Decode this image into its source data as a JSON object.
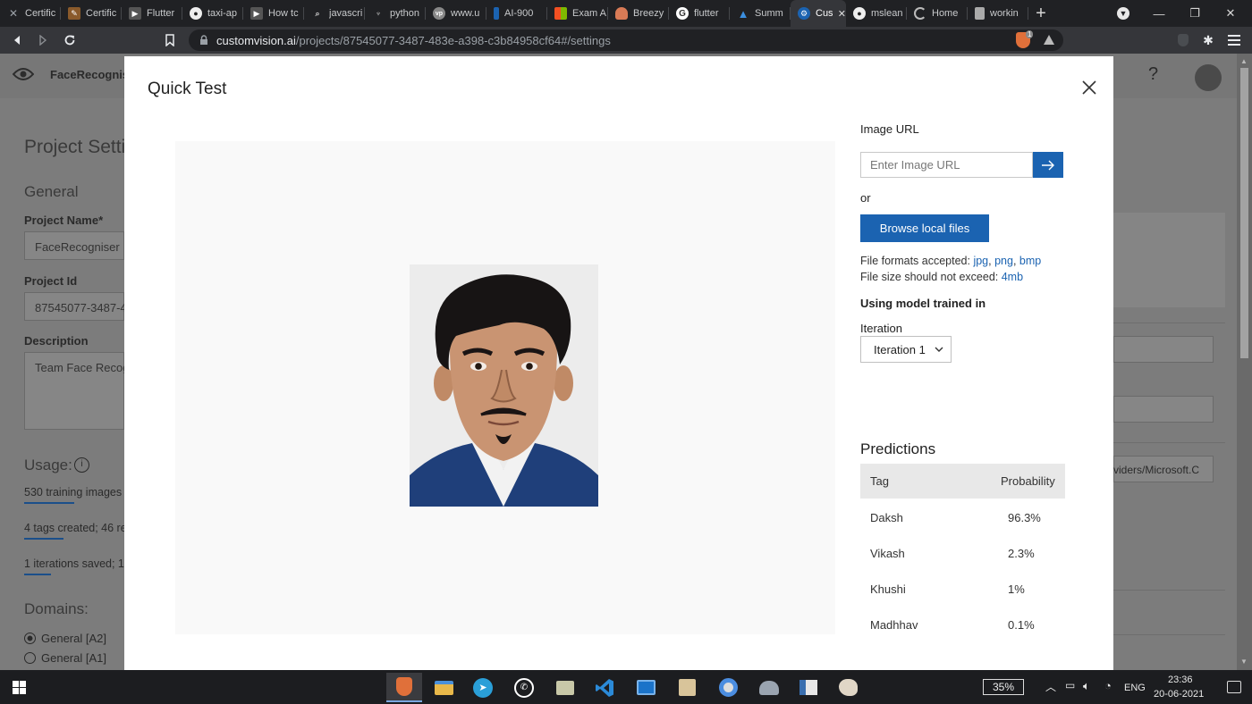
{
  "browser": {
    "tabs": [
      {
        "label": "Certific",
        "icon": "x-icon"
      },
      {
        "label": "Certific",
        "icon": "certificate-icon"
      },
      {
        "label": "Flutter",
        "icon": "youtube-icon"
      },
      {
        "label": "taxi-ap",
        "icon": "github-icon"
      },
      {
        "label": "How tc",
        "icon": "youtube-icon"
      },
      {
        "label": "javascri",
        "icon": "search-icon"
      },
      {
        "label": "python",
        "icon": "python-icon"
      },
      {
        "label": "www.u",
        "icon": "website-icon"
      },
      {
        "label": "AI-900",
        "icon": "azure-icon"
      },
      {
        "label": "Exam A",
        "icon": "windows-icon"
      },
      {
        "label": "Breezy",
        "icon": "breezy-icon"
      },
      {
        "label": "flutter",
        "icon": "google-icon"
      },
      {
        "label": "Summ",
        "icon": "azure-icon"
      },
      {
        "label": "Cus",
        "icon": "custom-vision-icon",
        "active": true
      },
      {
        "label": "mslean",
        "icon": "github-icon"
      },
      {
        "label": "Home",
        "icon": "loading-icon"
      },
      {
        "label": "workin",
        "icon": "page-icon"
      }
    ],
    "url_host": "customvision.ai",
    "url_path": "/projects/87545077-3487-483e-a398-c3b84958cf64#/settings",
    "brave_badge": "1"
  },
  "background": {
    "app_name": "FaceRecogniser",
    "section_title": "Project Setti",
    "general_heading": "General",
    "project_name_label": "Project Name*",
    "project_name_value": "FaceRecogniser",
    "project_id_label": "Project Id",
    "project_id_value": "87545077-3487-4",
    "description_label": "Description",
    "description_value": "Team Face Recog",
    "usage_heading": "Usage:",
    "usage_line1": "530 training images",
    "usage_line2": "4 tags created; 46 re",
    "usage_line3": "1 iterations saved; 1",
    "domains_heading": "Domains:",
    "domain1": "General [A2]",
    "domain2": "General [A1]",
    "right_field_text": "viders/Microsoft.C"
  },
  "modal": {
    "title": "Quick Test",
    "image_url_label": "Image URL",
    "image_url_placeholder": "Enter Image URL",
    "or_text": "or",
    "browse_label": "Browse local files",
    "formats_prefix": "File formats accepted: ",
    "format1": "jpg",
    "format2": "png",
    "format3": "bmp",
    "size_prefix": "File size should not exceed: ",
    "size_value": "4mb",
    "model_label": "Using model trained in",
    "iteration_label": "Iteration",
    "iteration_selected": "Iteration 1",
    "predictions_title": "Predictions",
    "col_tag": "Tag",
    "col_probability": "Probability",
    "predictions": [
      {
        "tag": "Daksh",
        "probability": "96.3%"
      },
      {
        "tag": "Vikash",
        "probability": "2.3%"
      },
      {
        "tag": "Khushi",
        "probability": "1%"
      },
      {
        "tag": "Madhhav",
        "probability": "0.1%"
      }
    ]
  },
  "taskbar": {
    "battery": "35%",
    "language": "ENG",
    "time": "23:36",
    "date": "20-06-2021"
  },
  "colors": {
    "accent": "#1b63b1",
    "overlay": "#7c7c7c"
  }
}
